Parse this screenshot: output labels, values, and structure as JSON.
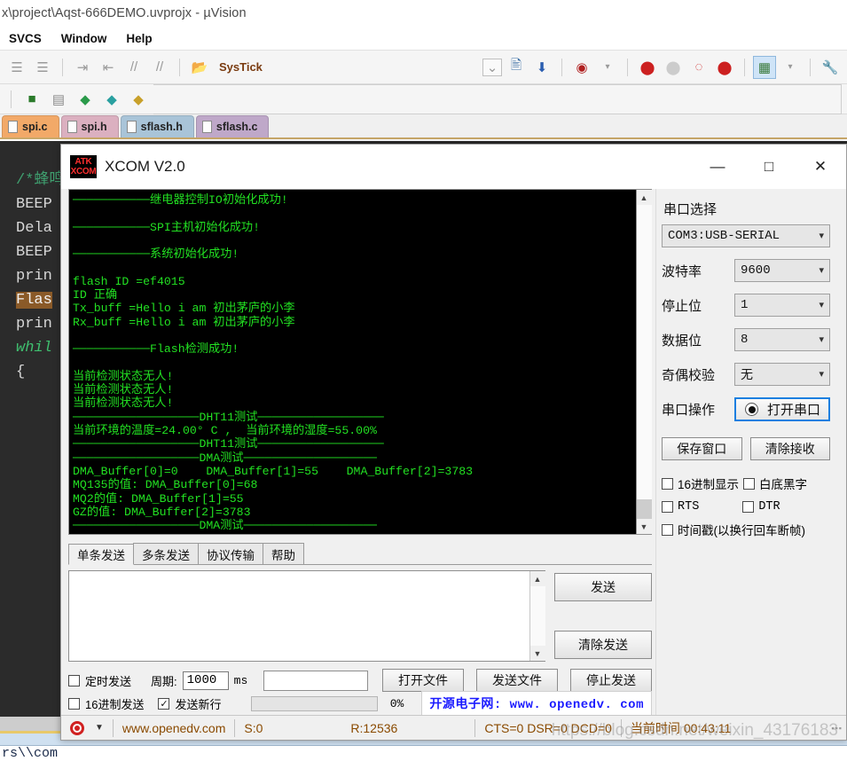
{
  "keil": {
    "title": "x\\project\\Aqst-666DEMO.uvprojx - µVision",
    "menus": [
      "SVCS",
      "Window",
      "Help"
    ],
    "toolbar": {
      "target_label": "SysTick",
      "icons": [
        "bookmark-prev-icon",
        "bookmark-next-icon",
        "indent-icon",
        "outdent-icon",
        "comment-icon",
        "uncomment-icon",
        "open-folder-icon",
        "target-options-icon",
        "download-icon",
        "debug-icon",
        "breakpoint-icon",
        "breakpoint-disabled-icon",
        "breakpoint-all-icon",
        "breakpoint-kill-icon",
        "window-layout-icon",
        "configure-icon"
      ]
    },
    "toolbar2_icons": [
      "build-icon",
      "rebuild-icon",
      "batch-build-icon",
      "translate-icon",
      "project-manage-icon"
    ],
    "tabs": [
      {
        "label": "spi.c",
        "color": "#f2a968"
      },
      {
        "label": "spi.h",
        "color": "#dbb0c0"
      },
      {
        "label": "sflash.h",
        "color": "#a9c4d8"
      },
      {
        "label": "sflash.c",
        "color": "#bfa8c9"
      }
    ],
    "code_lines": [
      "/*蜂鸣",
      "BEEP",
      "Dela",
      "BEEP",
      "prin",
      "Flas",
      "prin",
      "whil",
      "{"
    ],
    "bottom_text": "rs\\\\com"
  },
  "xcom": {
    "title": "XCOM V2.0",
    "logo_line1": "ATK",
    "logo_line2": "XCOM",
    "window_buttons": {
      "minimize": "—",
      "maximize": "□",
      "close": "✕"
    },
    "terminal_text": "───────────继电器控制IO初始化成功!\n\n───────────SPI主机初始化成功!\n\n───────────系统初始化成功!\n\nflash ID =ef4015\nID 正确\nTx_buff =Hello i am 初出茅庐的小李\nRx_buff =Hello i am 初出茅庐的小李\n\n───────────Flash检测成功!\n\n当前检测状态无人!\n当前检测状态无人!\n当前检测状态无人!\n──────────────────DHT11测试──────────────────\n当前环境的温度=24.00° C ,  当前环境的湿度=55.00%\n──────────────────DHT11测试──────────────────\n──────────────────DMA测试───────────────────\nDMA_Buffer[0]=0    DMA_Buffer[1]=55    DMA_Buffer[2]=3783\nMQ135的值: DMA_Buffer[0]=68\nMQ2的值: DMA_Buffer[1]=55\nGZ的值: DMA_Buffer[2]=3783\n──────────────────DMA测试───────────────────\n",
    "send_tabs": [
      {
        "label": "单条发送",
        "active": true
      },
      {
        "label": "多条发送",
        "active": false
      },
      {
        "label": "协议传输",
        "active": false
      },
      {
        "label": "帮助",
        "active": false
      }
    ],
    "send_input_value": "",
    "send_button": "发送",
    "clear_send_button": "清除发送",
    "options": {
      "timed_send_label": "定时发送",
      "timed_send_checked": false,
      "period_label": "周期:",
      "period_value": "1000",
      "ms_label": "ms",
      "hex_send_label": "16进制发送",
      "hex_send_checked": false,
      "newline_label": "发送新行",
      "newline_checked": true,
      "file_path_value": "",
      "progress_percent": "0%",
      "open_file_button": "打开文件",
      "send_file_button": "发送文件",
      "stop_send_button": "停止发送",
      "openedv_banner": "开源电子网: www. openedv. com"
    },
    "right_panel": {
      "port_section_label": "串口选择",
      "port_value": "COM3:USB-SERIAL",
      "baud_label": "波特率",
      "baud_value": "9600",
      "stopbits_label": "停止位",
      "stopbits_value": "1",
      "databits_label": "数据位",
      "databits_value": "8",
      "parity_label": "奇偶校验",
      "parity_value": "无",
      "operation_label": "串口操作",
      "open_port_button": "打开串口",
      "save_window_button": "保存窗口",
      "clear_receive_button": "清除接收",
      "hex_display_label": "16进制显示",
      "hex_display_checked": false,
      "white_bg_label": "白底黑字",
      "white_bg_checked": false,
      "rts_label": "RTS",
      "rts_checked": false,
      "dtr_label": "DTR",
      "dtr_checked": false,
      "timestamp_label": "时间戳(以换行回车断帧)",
      "timestamp_checked": false
    },
    "status": {
      "site": "www.openedv.com",
      "sent": "S:0",
      "received": "R:12536",
      "flags": "CTS=0 DSR=0 DCD=0",
      "time": "当前时间 00:43:11"
    }
  },
  "watermark": "https://blog.csdn.net/weixin_43176183",
  "colors": {
    "terminal_green": "#22e022",
    "terminal_bg": "#000000",
    "accent_blue": "#1c7fe0",
    "openedv_blue": "#1a1aff",
    "status_orange": "#8a4a00"
  }
}
